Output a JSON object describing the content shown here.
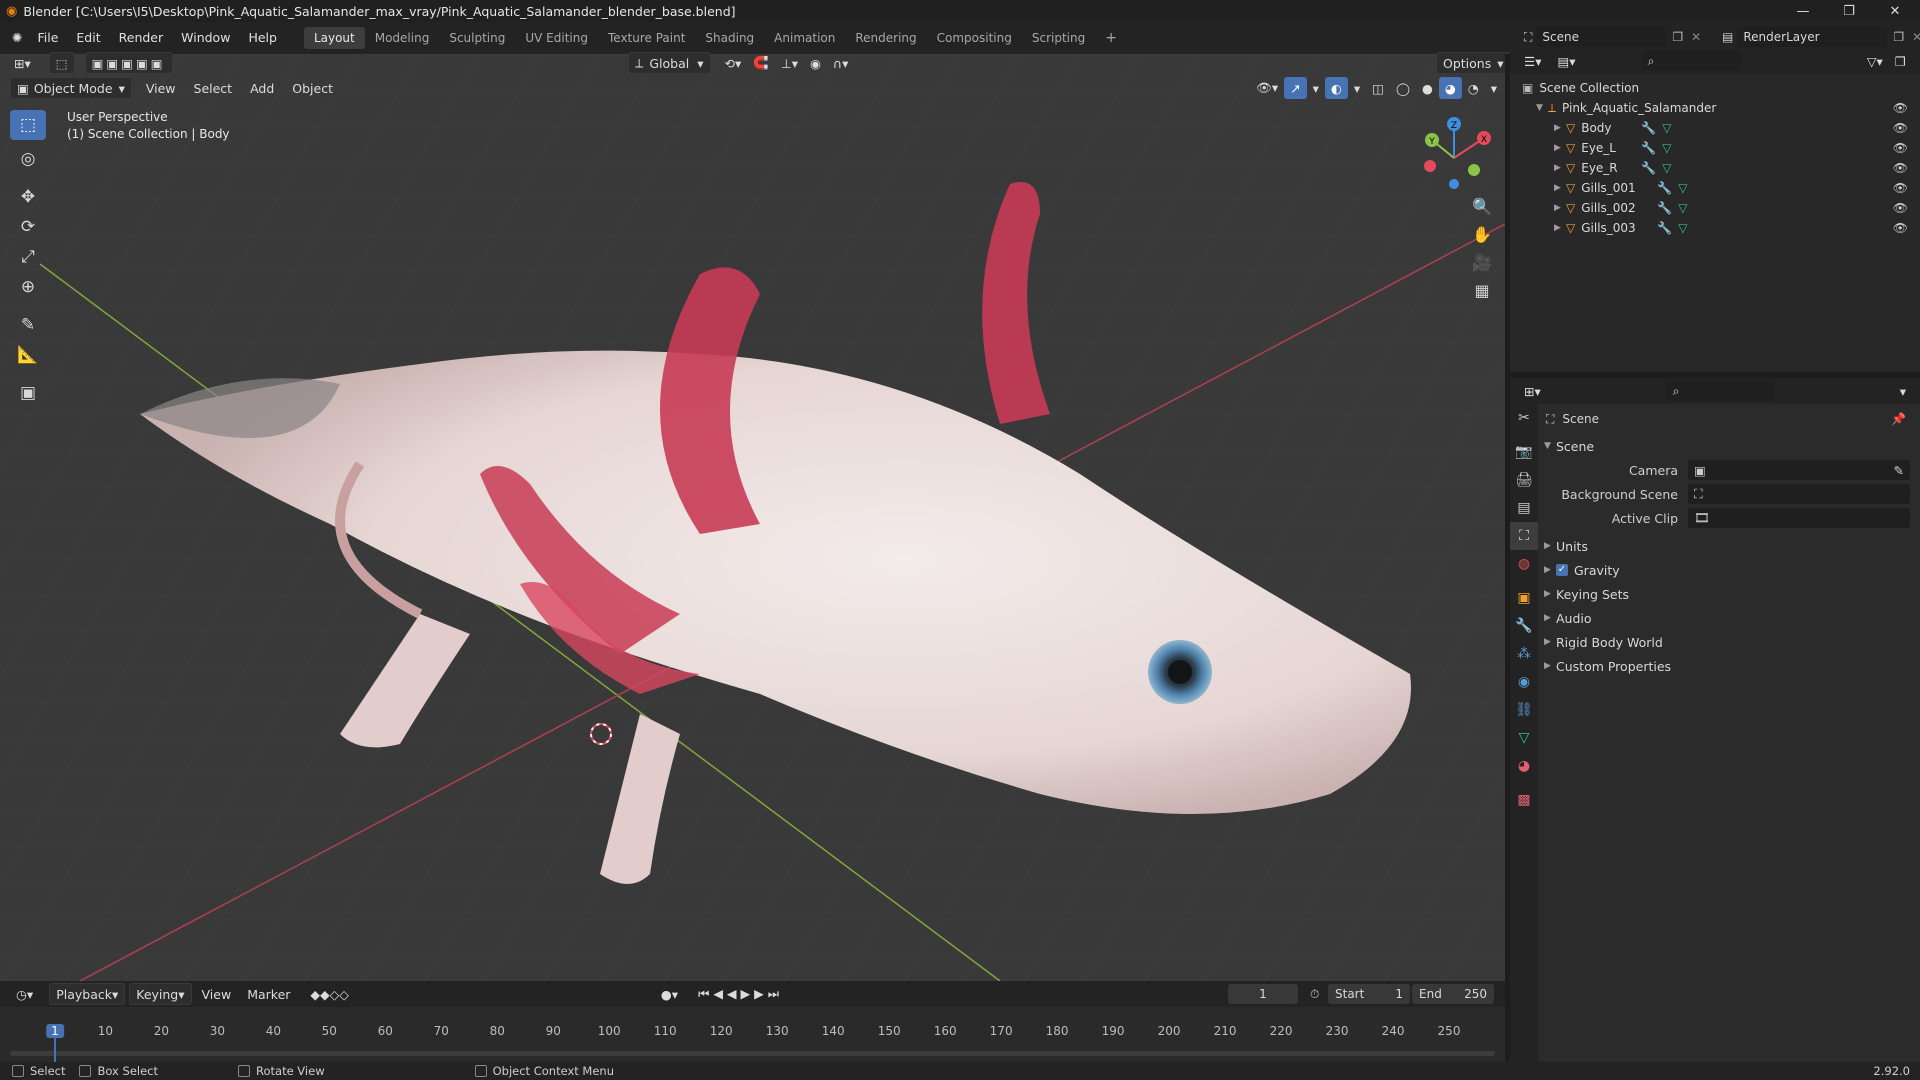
{
  "window": {
    "title": "Blender [C:\\Users\\I5\\Desktop\\Pink_Aquatic_Salamander_max_vray/Pink_Aquatic_Salamander_blender_base.blend]"
  },
  "menu": [
    "File",
    "Edit",
    "Render",
    "Window",
    "Help"
  ],
  "workspaces": [
    "Layout",
    "Modeling",
    "Sculpting",
    "UV Editing",
    "Texture Paint",
    "Shading",
    "Animation",
    "Rendering",
    "Compositing",
    "Scripting"
  ],
  "active_workspace": "Layout",
  "scene": {
    "name": "Scene",
    "render_layer": "RenderLayer"
  },
  "toolbar_header": {
    "transform_orientation": "Global",
    "options": "Options"
  },
  "viewport_header": {
    "mode": "Object Mode",
    "menus": [
      "View",
      "Select",
      "Add",
      "Object"
    ]
  },
  "viewport": {
    "perspective": "User Perspective",
    "collection_info": "(1) Scene Collection | Body"
  },
  "gizmo": {
    "x": "X",
    "y": "Y",
    "z": "Z"
  },
  "colors": {
    "accent": "#4772b3",
    "x_axis": "#e44b5a",
    "y_axis": "#8bc34a",
    "z_axis": "#3f8fe0",
    "mesh_icon": "#f0a030",
    "data_icon": "#2fbf8f",
    "frame": "#4772b3"
  },
  "outliner": {
    "root": "Scene Collection",
    "collection": "Pink_Aquatic_Salamander",
    "objects": [
      "Body",
      "Eye_L",
      "Eye_R",
      "Gills_001",
      "Gills_002",
      "Gills_003"
    ]
  },
  "properties": {
    "context": "Scene",
    "panel": "Scene",
    "fields": [
      {
        "label": "Camera",
        "value": ""
      },
      {
        "label": "Background Scene",
        "value": ""
      },
      {
        "label": "Active Clip",
        "value": ""
      }
    ],
    "subpanels": [
      "Units",
      "Gravity",
      "Keying Sets",
      "Audio",
      "Rigid Body World",
      "Custom Properties"
    ],
    "gravity_checked": true
  },
  "timeline": {
    "menus": [
      "Playback",
      "Keying",
      "View",
      "Marker"
    ],
    "current_frame": "1",
    "start_label": "Start",
    "start": "1",
    "end_label": "End",
    "end": "250",
    "ticks": [
      "1",
      "10",
      "20",
      "30",
      "40",
      "50",
      "60",
      "70",
      "80",
      "90",
      "100",
      "110",
      "120",
      "130",
      "140",
      "150",
      "160",
      "170",
      "180",
      "190",
      "200",
      "210",
      "220",
      "230",
      "240",
      "250"
    ]
  },
  "status": {
    "select": "Select",
    "box_select": "Box Select",
    "rotate_view": "Rotate View",
    "context_menu": "Object Context Menu",
    "version": "2.92.0"
  }
}
